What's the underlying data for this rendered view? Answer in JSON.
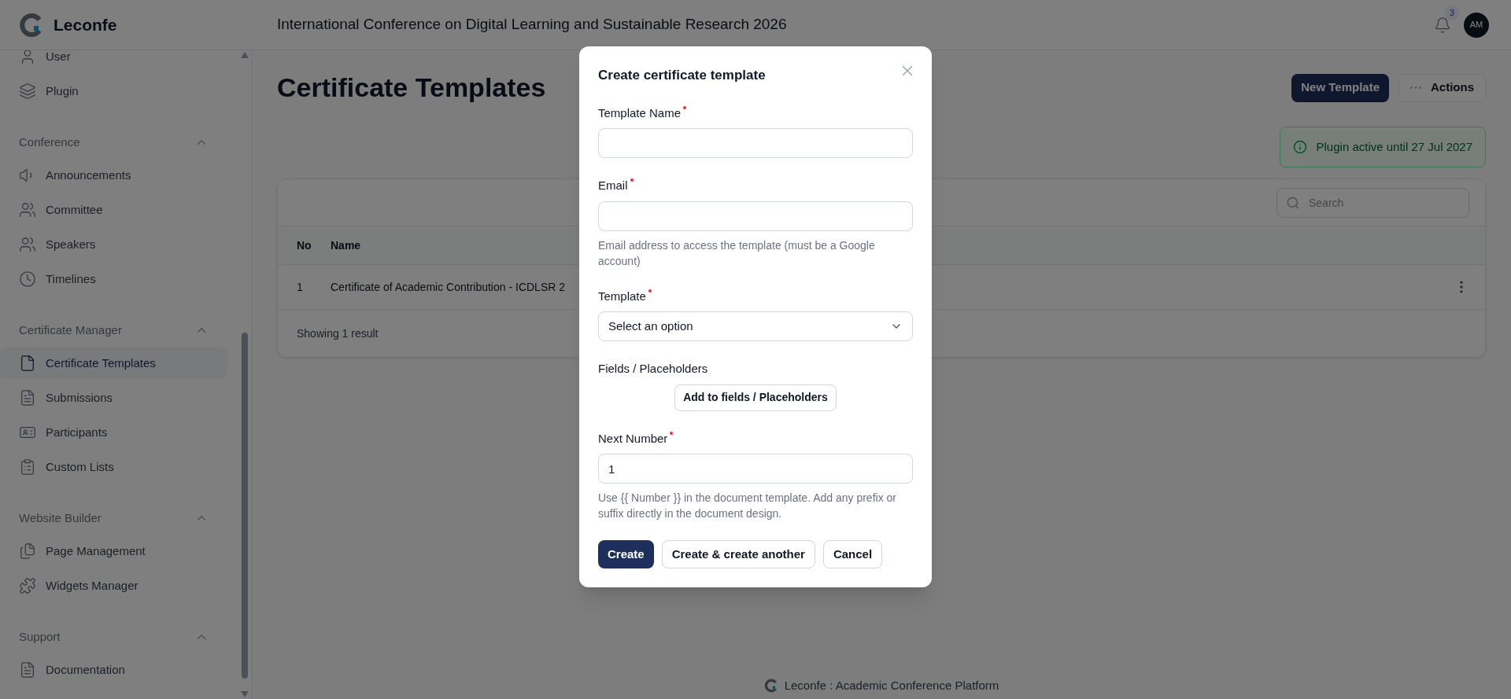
{
  "header": {
    "brand": "Leconfe",
    "title": "International Conference on Digital Learning and Sustainable Research 2026",
    "notification_count": "3",
    "avatar": "AM"
  },
  "sidebar": {
    "top_items": [
      {
        "label": "User",
        "selected": false
      },
      {
        "label": "Plugin",
        "selected": false
      }
    ],
    "sections": [
      {
        "title": "Conference",
        "expanded": true,
        "items": [
          {
            "label": "Announcements",
            "selected": false
          },
          {
            "label": "Committee",
            "selected": false
          },
          {
            "label": "Speakers",
            "selected": false
          },
          {
            "label": "Timelines",
            "selected": false
          }
        ]
      },
      {
        "title": "Certificate Manager",
        "expanded": true,
        "items": [
          {
            "label": "Certificate Templates",
            "selected": true
          },
          {
            "label": "Submissions",
            "selected": false
          },
          {
            "label": "Participants",
            "selected": false
          },
          {
            "label": "Custom Lists",
            "selected": false
          }
        ]
      },
      {
        "title": "Website Builder",
        "expanded": true,
        "items": [
          {
            "label": "Page Management",
            "selected": false
          },
          {
            "label": "Widgets Manager",
            "selected": false
          }
        ]
      },
      {
        "title": "Support",
        "expanded": true,
        "items": [
          {
            "label": "Documentation",
            "selected": false
          }
        ]
      }
    ]
  },
  "page": {
    "title": "Certificate Templates",
    "actions": [
      {
        "label": "New Template",
        "kind": "primary"
      },
      {
        "label": "Actions",
        "kind": "menu"
      }
    ],
    "notice": "Plugin active until 27 Jul 2027",
    "table": {
      "search": {
        "placeholder": "Search"
      },
      "columns": [
        "No",
        "Name"
      ],
      "rows": [
        {
          "cells": [
            "1",
            "Certificate of Academic Contribution - ICDLSR 2"
          ]
        }
      ],
      "footer": "Showing 1 result"
    }
  },
  "modal": {
    "title": "Create certificate template",
    "fields": [
      {
        "kind": "input",
        "label": "Template Name",
        "required": true
      },
      {
        "kind": "input",
        "label": "Email",
        "required": true,
        "help": "Email address to access the template (must be a Google account)"
      },
      {
        "kind": "select",
        "label": "Template",
        "required": true,
        "value": "Select an option"
      },
      {
        "kind": "button",
        "label": "Fields / Placeholders",
        "required": false,
        "button": "Add to fields / Placeholders"
      },
      {
        "kind": "input",
        "label": "Next Number",
        "required": true,
        "value": "1",
        "help": "Use {{ Number }} in the document template. Add any prefix or suffix directly in the document design."
      }
    ],
    "buttons": [
      {
        "label": "Create",
        "kind": "primary"
      },
      {
        "label": "Create & create another",
        "kind": "secondary"
      },
      {
        "label": "Cancel",
        "kind": "secondary"
      }
    ]
  },
  "footer": "Leconfe : Academic Conference Platform"
}
